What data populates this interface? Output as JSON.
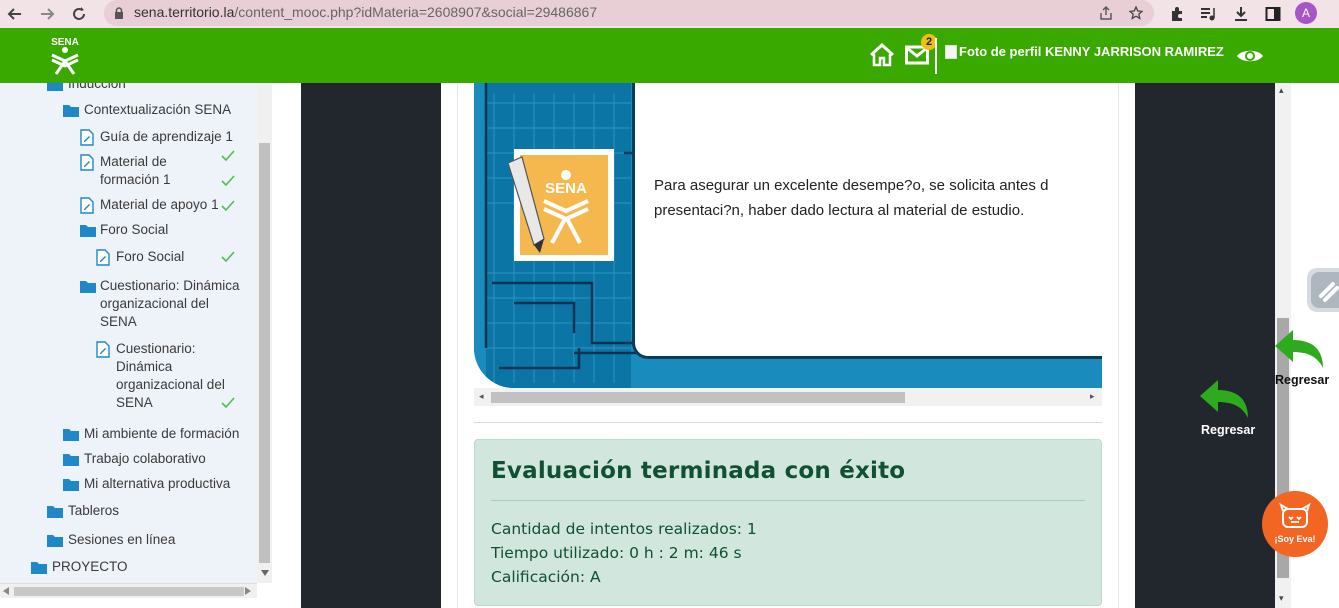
{
  "browser": {
    "url_host": "sena.territorio.la",
    "url_path": "/content_mooc.php?idMateria=2608907&social=29486867",
    "profile_initial": "A",
    "icons": [
      "back-icon",
      "forward-icon",
      "reload-icon",
      "lock-icon",
      "share-icon",
      "star-icon",
      "extensions-icon",
      "media-icon",
      "download-icon",
      "sidepanel-icon"
    ]
  },
  "header": {
    "logo_text": "SENA",
    "mail_count": "2",
    "profile_text": "Foto de perfil KENNY JARRISON RAMIREZ",
    "colors": {
      "brand_green": "#39a900"
    }
  },
  "sidebar": {
    "items": [
      {
        "label": "Inducción",
        "type": "folder"
      },
      {
        "label": "Contextualización SENA",
        "type": "folder"
      },
      {
        "label": "Guía de aprendizaje 1",
        "type": "doc",
        "done": false
      },
      {
        "label": "Material de formación 1",
        "label_l1": "Material de",
        "label_l2": "formación 1",
        "type": "doc",
        "done": true
      },
      {
        "label": "Material de apoyo 1",
        "type": "doc",
        "done": true
      },
      {
        "label": "Foro Social",
        "type": "folder"
      },
      {
        "label": "Foro Social",
        "type": "doc",
        "done": true
      },
      {
        "label_l1": "Cuestionario: Dinámica",
        "label_l2": "organizacional del",
        "label_l3": "SENA",
        "type": "folder"
      },
      {
        "label_l1": "Cuestionario:",
        "label_l2": "Dinámica",
        "label_l3": "organizacional del",
        "label_l4": "SENA",
        "type": "doc",
        "done": true
      },
      {
        "label": "Mi ambiente de formación",
        "type": "folder"
      },
      {
        "label": "Trabajo colaborativo",
        "type": "folder"
      },
      {
        "label": "Mi alternativa productiva",
        "type": "folder"
      },
      {
        "label": "Tableros",
        "type": "folder"
      },
      {
        "label": "Sesiones en línea",
        "type": "folder"
      },
      {
        "label": "PROYECTO",
        "type": "folder"
      }
    ]
  },
  "slide": {
    "logo_text": "SENA",
    "line1": "Para asegurar un excelente desempe?o, se solicita antes d",
    "line2": "presentaci?n, haber dado lectura al material de estudio."
  },
  "result": {
    "title": "Evaluación terminada con éxito",
    "attempts": "Cantidad de intentos realizados: 1",
    "time": "Tiempo utilizado: 0 h : 2 m: 46 s",
    "grade": "Calificación: A"
  },
  "right": {
    "back_label_1": "Regresar",
    "back_label_2": "Regresar",
    "eva_label": "¡Soy Eva!"
  }
}
